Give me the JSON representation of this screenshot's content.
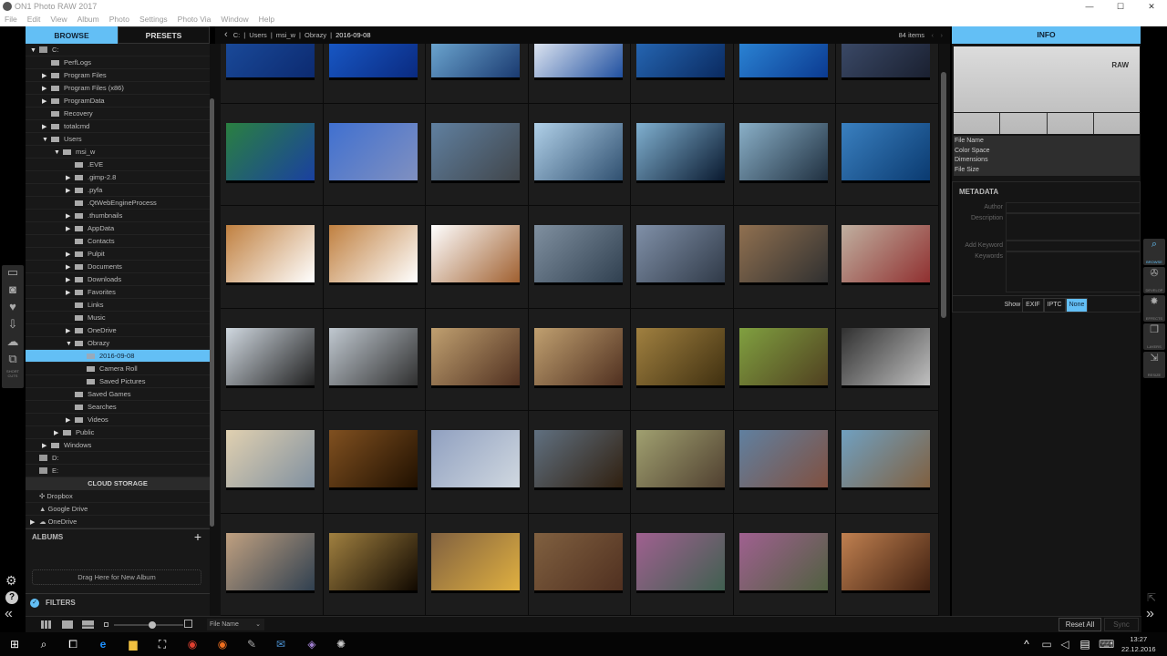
{
  "app": {
    "title": "ON1 Photo RAW 2017",
    "window_controls": [
      "—",
      "☐",
      "✕"
    ]
  },
  "menu": [
    "File",
    "Edit",
    "View",
    "Album",
    "Photo",
    "Settings",
    "Photo Via",
    "Window",
    "Help"
  ],
  "left_tabs": {
    "browse": "BROWSE",
    "presets": "PRESETS"
  },
  "left_strip": {
    "shortcuts_label": "SHORT CUTS"
  },
  "tree": [
    {
      "label": "C:",
      "level": 0,
      "toggle": "▼",
      "type": "drive"
    },
    {
      "label": "PerfLogs",
      "level": 1,
      "toggle": ""
    },
    {
      "label": "Program Files",
      "level": 1,
      "toggle": "▶"
    },
    {
      "label": "Program Files (x86)",
      "level": 1,
      "toggle": "▶"
    },
    {
      "label": "ProgramData",
      "level": 1,
      "toggle": "▶"
    },
    {
      "label": "Recovery",
      "level": 1,
      "toggle": ""
    },
    {
      "label": "totalcmd",
      "level": 1,
      "toggle": "▶"
    },
    {
      "label": "Users",
      "level": 1,
      "toggle": "▼"
    },
    {
      "label": "msi_w",
      "level": 2,
      "toggle": "▼"
    },
    {
      "label": ".EVE",
      "level": 3,
      "toggle": ""
    },
    {
      "label": ".gimp-2.8",
      "level": 3,
      "toggle": "▶"
    },
    {
      "label": ".pyfa",
      "level": 3,
      "toggle": "▶"
    },
    {
      "label": ".QtWebEngineProcess",
      "level": 3,
      "toggle": ""
    },
    {
      "label": ".thumbnails",
      "level": 3,
      "toggle": "▶"
    },
    {
      "label": "AppData",
      "level": 3,
      "toggle": "▶"
    },
    {
      "label": "Contacts",
      "level": 3,
      "toggle": ""
    },
    {
      "label": "Pulpit",
      "level": 3,
      "toggle": "▶"
    },
    {
      "label": "Documents",
      "level": 3,
      "toggle": "▶"
    },
    {
      "label": "Downloads",
      "level": 3,
      "toggle": "▶"
    },
    {
      "label": "Favorites",
      "level": 3,
      "toggle": "▶"
    },
    {
      "label": "Links",
      "level": 3,
      "toggle": ""
    },
    {
      "label": "Music",
      "level": 3,
      "toggle": ""
    },
    {
      "label": "OneDrive",
      "level": 3,
      "toggle": "▶"
    },
    {
      "label": "Obrazy",
      "level": 3,
      "toggle": "▼"
    },
    {
      "label": "2016-09-08",
      "level": 4,
      "toggle": "",
      "selected": true
    },
    {
      "label": "Camera Roll",
      "level": 4,
      "toggle": ""
    },
    {
      "label": "Saved Pictures",
      "level": 4,
      "toggle": ""
    },
    {
      "label": "Saved Games",
      "level": 3,
      "toggle": ""
    },
    {
      "label": "Searches",
      "level": 3,
      "toggle": ""
    },
    {
      "label": "Videos",
      "level": 3,
      "toggle": "▶"
    },
    {
      "label": "Public",
      "level": 2,
      "toggle": "▶"
    },
    {
      "label": "Windows",
      "level": 1,
      "toggle": "▶"
    },
    {
      "label": "D:",
      "level": 0,
      "toggle": "",
      "type": "drive"
    },
    {
      "label": "E:",
      "level": 0,
      "toggle": "",
      "type": "drive"
    }
  ],
  "cloud": {
    "title": "CLOUD STORAGE",
    "items": [
      {
        "label": "Dropbox",
        "toggle": ""
      },
      {
        "label": "Google Drive",
        "toggle": ""
      },
      {
        "label": "OneDrive",
        "toggle": "▶"
      }
    ]
  },
  "albums": {
    "title": "ALBUMS",
    "add": "+",
    "drop_hint": "Drag Here for New Album"
  },
  "filters": {
    "title": "FILTERS"
  },
  "breadcrumb": {
    "parts": [
      "C:",
      "Users",
      "msi_w",
      "Obrazy",
      "2016-09-08"
    ],
    "count": "84 items"
  },
  "thumbs": [
    [
      "#1c4fa0",
      "#0c2a70"
    ],
    [
      "#1a5fd0",
      "#0a2a80"
    ],
    [
      "#7ab8e0",
      "#1a3a70"
    ],
    [
      "#ffffff",
      "#2050a0"
    ],
    [
      "#2a70c0",
      "#0a2a60"
    ],
    [
      "#3090e0",
      "#0b3a90"
    ],
    [
      "#405070",
      "#1a2030"
    ],
    [
      "#2a8040",
      "#1a40a0"
    ],
    [
      "#4070d0",
      "#8090c0"
    ],
    [
      "#6080a0",
      "#40454a"
    ],
    [
      "#b0d0e8",
      "#305070"
    ],
    [
      "#80b0d0",
      "#0a1a30"
    ],
    [
      "#8ab0c8",
      "#203040"
    ],
    [
      "#3a80c0",
      "#0a3a70"
    ],
    [
      "#c08040",
      "#fff"
    ],
    [
      "#c08040",
      "#fff"
    ],
    [
      "#fff",
      "#a06030"
    ],
    [
      "#8090a0",
      "#304050"
    ],
    [
      "#8090a8",
      "#303a48"
    ],
    [
      "#907050",
      "#303030"
    ],
    [
      "#c0b0a0",
      "#903030"
    ],
    [
      "#d0d8e0",
      "#202020"
    ],
    [
      "#c0c8d0",
      "#303030"
    ],
    [
      "#c0a070",
      "#503020"
    ],
    [
      "#c0a070",
      "#503020"
    ],
    [
      "#a08040",
      "#403010"
    ],
    [
      "#80a040",
      "#504020"
    ],
    [
      "#303030",
      "#c0c0c0"
    ],
    [
      "#e0d0b0",
      "#8090a0"
    ],
    [
      "#805020",
      "#201000"
    ],
    [
      "#90a0c0",
      "#d0d8e0"
    ],
    [
      "#607080",
      "#302010"
    ],
    [
      "#a0a070",
      "#504030"
    ],
    [
      "#6080a0",
      "#805040"
    ],
    [
      "#70a0c0",
      "#806040"
    ],
    [
      "#c0a080",
      "#304050"
    ],
    [
      "#a08040",
      "#100800"
    ],
    [
      "#806040",
      "#e0b040"
    ],
    [
      "#806040",
      "#503020"
    ],
    [
      "#a06090",
      "#406050"
    ],
    [
      "#a06090",
      "#506040"
    ],
    [
      "#c08050",
      "#402010"
    ]
  ],
  "right_panel": {
    "tab": "INFO",
    "raw_badge": "RAW",
    "info_fields": [
      "File Name",
      "Color Space",
      "Dimensions",
      "File Size"
    ],
    "metadata_title": "METADATA",
    "meta_fields": [
      "Author",
      "Description",
      "Add Keyword",
      "Keywords"
    ],
    "show_label": "Show",
    "show_options": [
      "EXIF",
      "IPTC",
      "None"
    ],
    "show_selected": "None",
    "reset": "Reset All",
    "sync": "Sync"
  },
  "modules": [
    "BROWSE",
    "DEVELOP",
    "EFFECTS",
    "LAYERS",
    "RESIZE"
  ],
  "bottom": {
    "sort": "File Name",
    "thumb_size": 0.55
  },
  "taskbar": {
    "time": "13:27",
    "date": "22.12.2016"
  },
  "colors": {
    "accent": "#63bff5"
  }
}
